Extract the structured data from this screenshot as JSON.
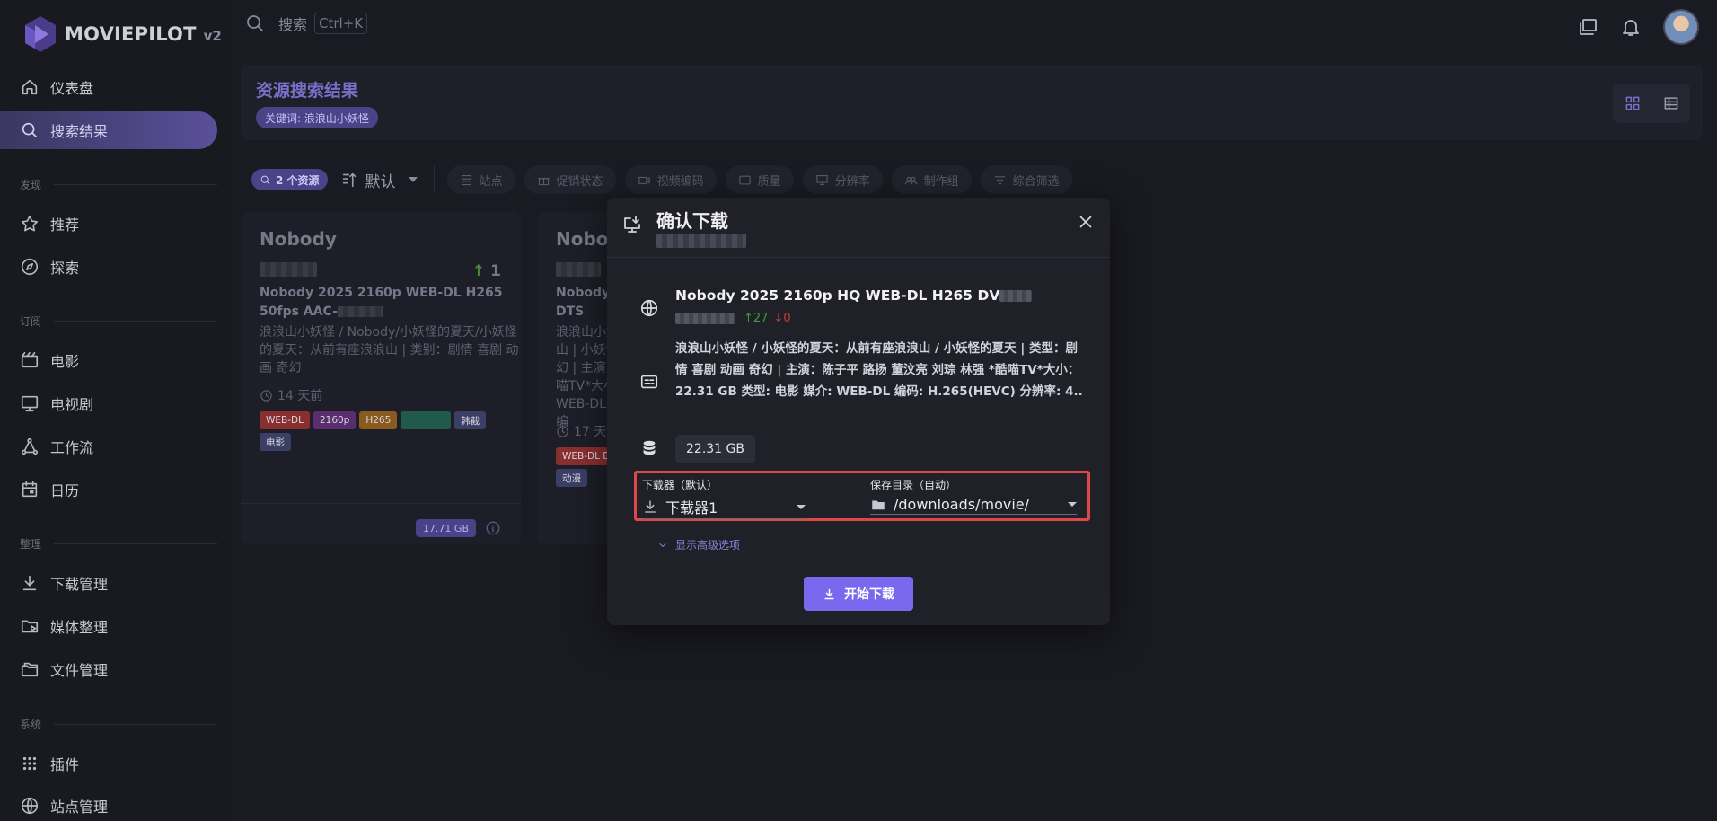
{
  "app": {
    "name": "MOVIEPILOT",
    "version": "v2"
  },
  "topbar": {
    "search_placeholder": "搜索",
    "shortcut": "Ctrl+K"
  },
  "sidebar": {
    "items": [
      {
        "label": "仪表盘",
        "icon": "home-icon",
        "active": false
      },
      {
        "label": "搜索结果",
        "icon": "search-icon",
        "active": true
      }
    ],
    "sections": [
      {
        "title": "发现",
        "items": [
          {
            "label": "推荐",
            "icon": "star-icon"
          },
          {
            "label": "探索",
            "icon": "compass-icon"
          }
        ]
      },
      {
        "title": "订阅",
        "items": [
          {
            "label": "电影",
            "icon": "movie-icon"
          },
          {
            "label": "电视剧",
            "icon": "tv-icon"
          },
          {
            "label": "工作流",
            "icon": "workflow-icon"
          },
          {
            "label": "日历",
            "icon": "calendar-icon"
          }
        ]
      },
      {
        "title": "整理",
        "items": [
          {
            "label": "下载管理",
            "icon": "download-icon"
          },
          {
            "label": "媒体整理",
            "icon": "folder-play-icon"
          },
          {
            "label": "文件管理",
            "icon": "files-icon"
          }
        ]
      },
      {
        "title": "系统",
        "items": [
          {
            "label": "插件",
            "icon": "grid-icon"
          },
          {
            "label": "站点管理",
            "icon": "globe-icon"
          }
        ]
      }
    ]
  },
  "header": {
    "title": "资源搜索结果",
    "keyword_chip": "关键词: 浪浪山小妖怪"
  },
  "filters": {
    "count": "2 个资源",
    "sort": "默认",
    "chips": [
      {
        "label": "站点",
        "icon": "server-icon"
      },
      {
        "label": "促销状态",
        "icon": "gift-icon"
      },
      {
        "label": "视频编码",
        "icon": "video-icon"
      },
      {
        "label": "质量",
        "icon": "hd-icon"
      },
      {
        "label": "分辨率",
        "icon": "monitor-icon"
      },
      {
        "label": "制作组",
        "icon": "group-icon"
      },
      {
        "label": "综合筛选",
        "icon": "filter-icon"
      }
    ]
  },
  "results": [
    {
      "title": "Nobody",
      "seeders": "1",
      "name": "Nobody 2025 2160p WEB-DL H265 50fps AAC-",
      "desc": "浪浪山小妖怪 / Nobody/小妖怪的夏天/小妖怪的夏天：从前有座浪浪山 | 类别：剧情 喜剧 动画 奇幻",
      "time": "14 天前",
      "tags": [
        {
          "label": "WEB-DL",
          "color": "#8a2f2f"
        },
        {
          "label": "2160p",
          "color": "#5a2d6e"
        },
        {
          "label": "H265",
          "color": "#8a5a1e"
        },
        {
          "label": "",
          "color": "#1f5a4a"
        },
        {
          "label": "韩截",
          "color": "#3b3f66"
        },
        {
          "label": "电影",
          "color": "#3b3f66"
        }
      ],
      "size": "17.71 GB"
    },
    {
      "title": "Nobo",
      "name": "Nobody 2",
      "name2": "DTS",
      "desc": "浪浪山小妖 山 | 小妖怪 幻 | 主演: 喵TV*大小 WEB-DL 编",
      "time": "17 天前",
      "tags": [
        {
          "label": "WEB-DL DV",
          "color": "#8a2f2f"
        },
        {
          "label": "动漫",
          "color": "#3b3f66"
        }
      ]
    }
  ],
  "dialog": {
    "title": "确认下载",
    "torrent_name": "Nobody 2025 2160p HQ WEB-DL H265 DV",
    "seeders": "↑27",
    "leechers": "↓0",
    "description": "浪浪山小妖怪 / 小妖怪的夏天：从前有座浪浪山 / 小妖怪的夏天 | 类型：剧情 喜剧 动画 奇幻 | 主演：陈子平 路扬 董汶亮 刘琮 林强 *酷喵TV*大小：22.31 GB 类型: 电影 媒介: WEB-DL 编码: H.265(HEVC) 分辨率: 4..",
    "size": "22.31 GB",
    "downloader_label": "下载器（默认）",
    "downloader_value": "下载器1",
    "save_dir_label": "保存目录（自动）",
    "save_dir_value": "/downloads/movie/",
    "advanced_label": "显示高级选项",
    "start_button": "开始下载"
  },
  "colors": {
    "accent": "#7b68ee",
    "highlight_border": "#e04848",
    "up": "#3f9c3a",
    "down": "#c9412e"
  }
}
